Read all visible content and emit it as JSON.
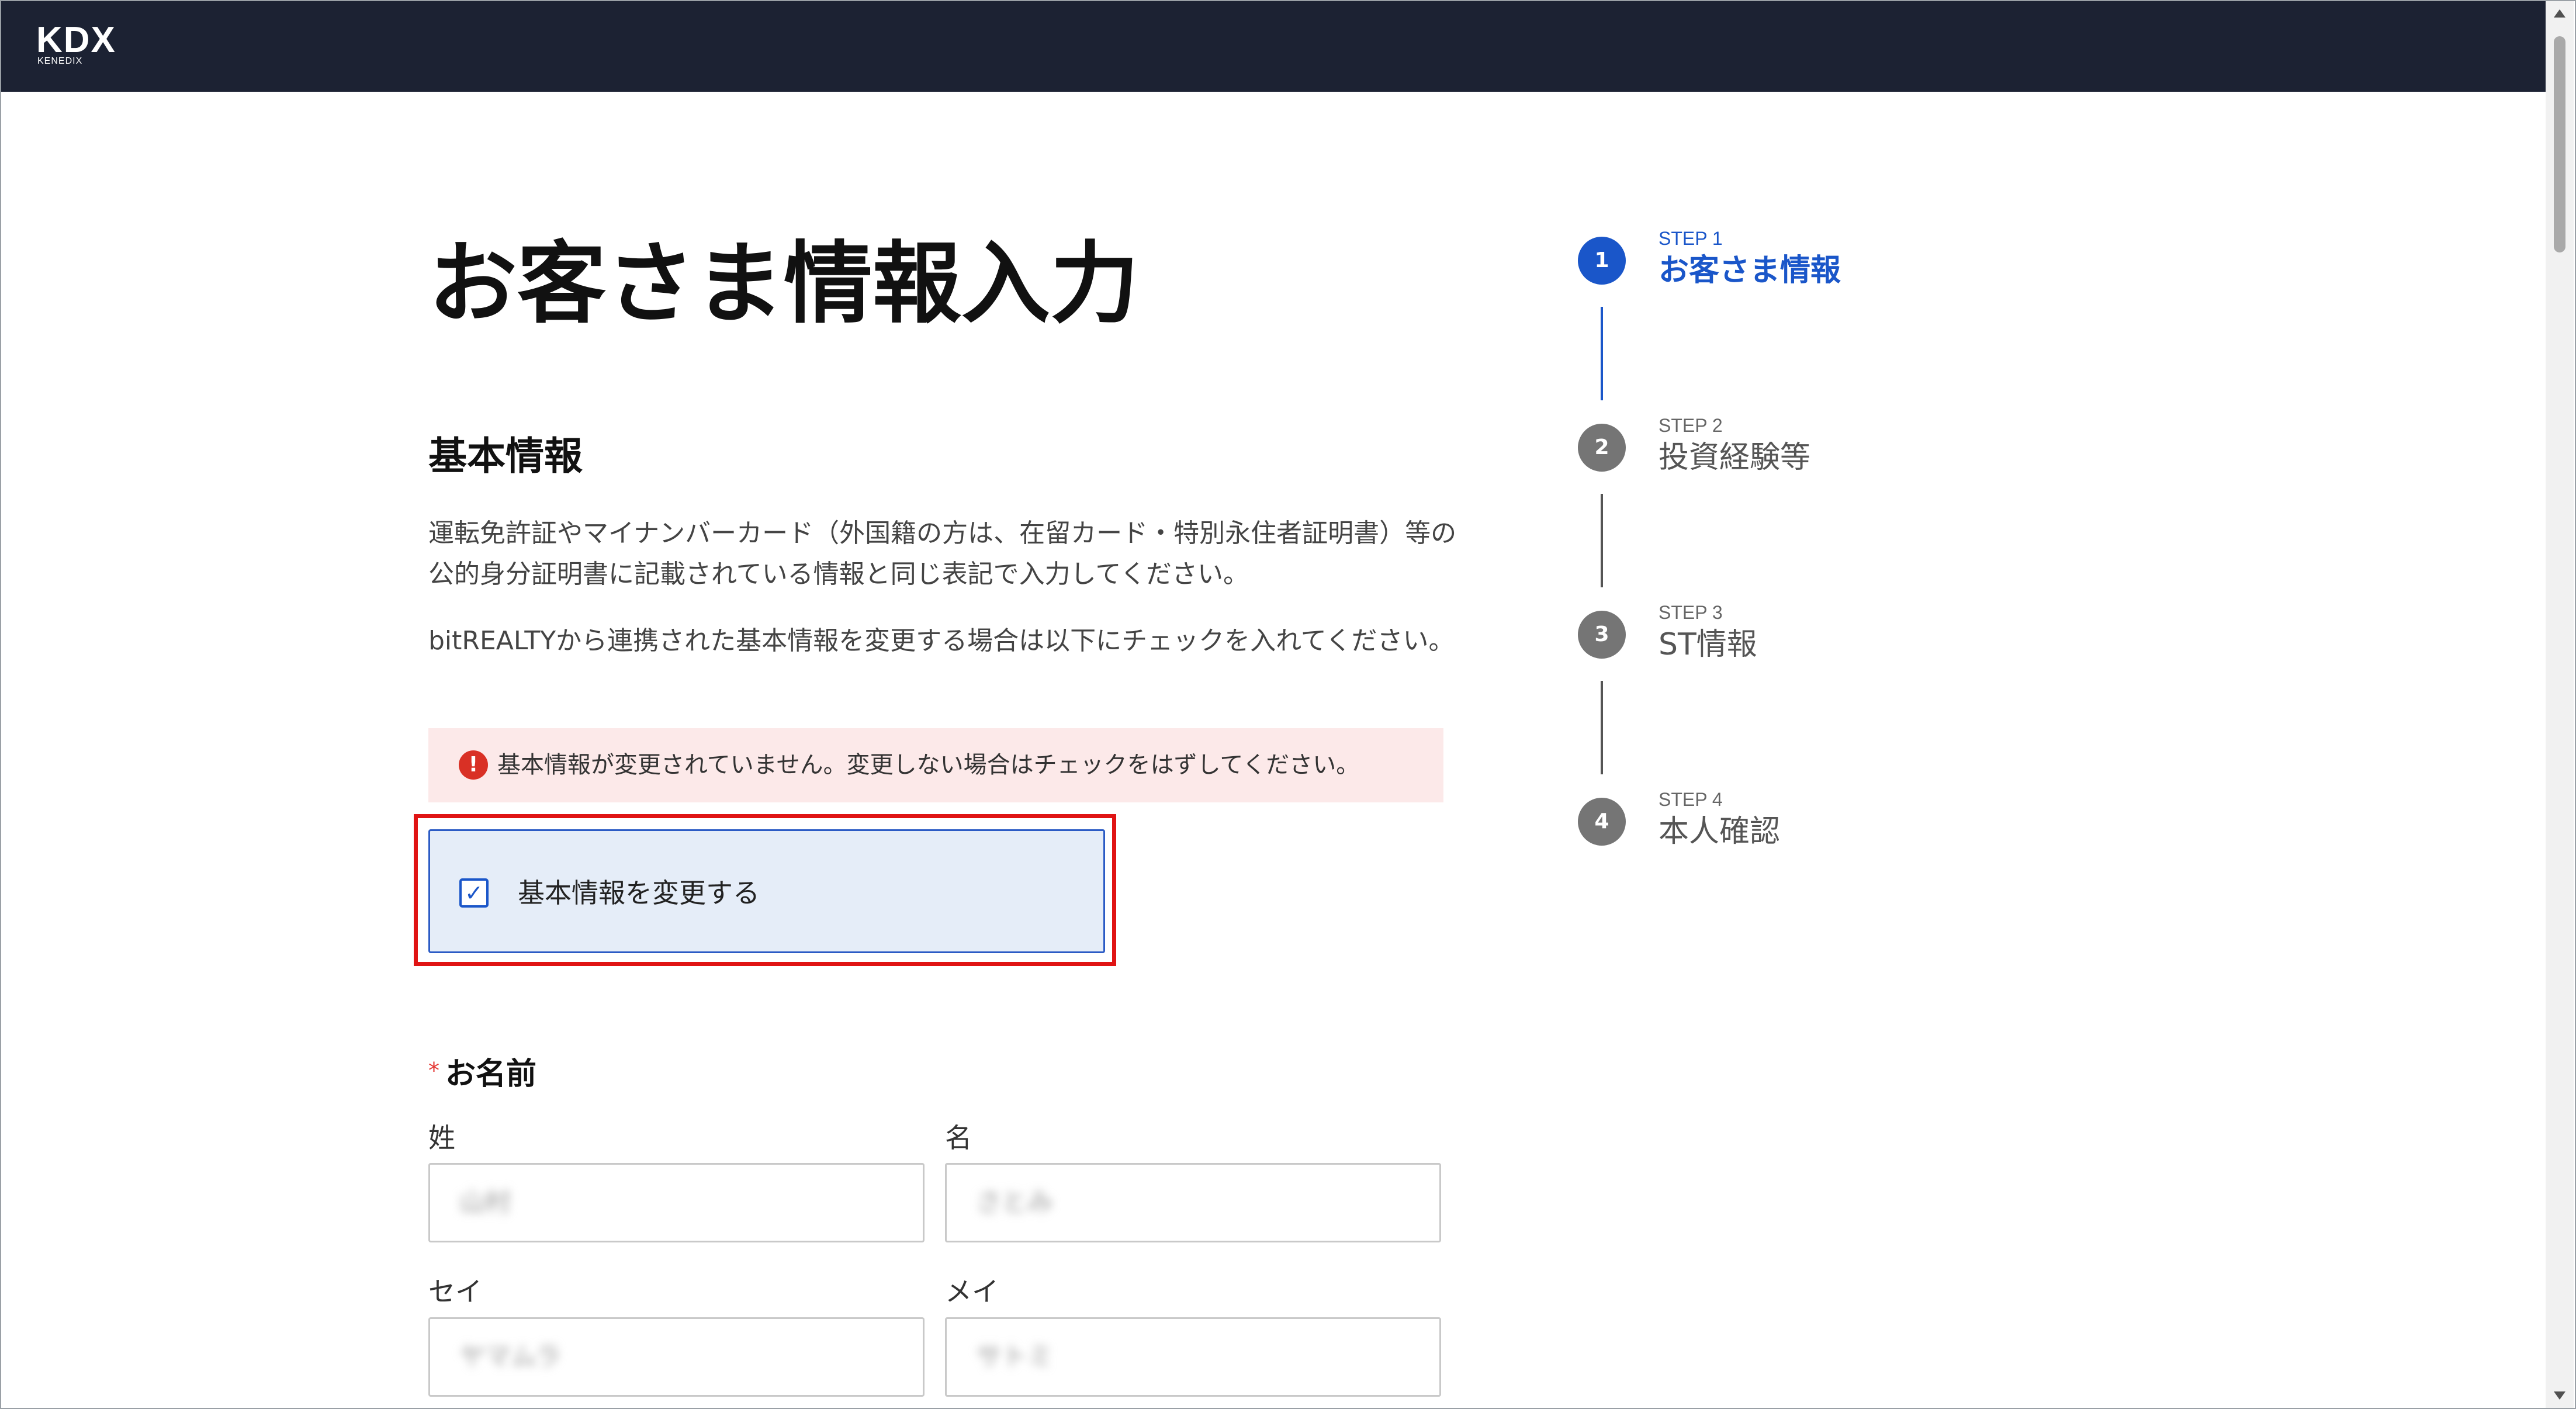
{
  "header": {
    "logo_main": "KDX",
    "logo_sub": "KENEDIX"
  },
  "page": {
    "title": "お客さま情報入力",
    "section_title": "基本情報",
    "paragraph1": "運転免許証やマイナンバーカード（外国籍の方は、在留カード・特別永住者証明書）等の公的身分証明書に記載されている情報と同じ表記で入力してください。",
    "paragraph2": "bitREALTYから連携された基本情報を変更する場合は以下にチェックを入れてください。",
    "alert": {
      "icon": "error-icon",
      "text": "基本情報が変更されていません。変更しない場合はチェックをはずしてください。"
    },
    "checkbox": {
      "label": "基本情報を変更する",
      "checked": true
    }
  },
  "name_field": {
    "required_mark": "*",
    "title": "お名前",
    "last_name_label": "姓",
    "first_name_label": "名",
    "last_name_kana_label": "セイ",
    "first_name_kana_label": "メイ",
    "last_name_value": "山村",
    "first_name_value": "さとみ",
    "last_name_kana_value": "ヤマムラ",
    "first_name_kana_value": "サトミ"
  },
  "steps": [
    {
      "number": "1",
      "label": "STEP 1",
      "name": "お客さま情報",
      "active": true
    },
    {
      "number": "2",
      "label": "STEP 2",
      "name": "投資経験等",
      "active": false
    },
    {
      "number": "3",
      "label": "STEP 3",
      "name": "ST情報",
      "active": false
    },
    {
      "number": "4",
      "label": "STEP 4",
      "name": "本人確認",
      "active": false
    }
  ],
  "colors": {
    "header_bg": "#1c2233",
    "accent": "#1a56c9",
    "alert_bg": "#fce9e9",
    "error": "#d93025",
    "highlight_border": "#e01414"
  }
}
